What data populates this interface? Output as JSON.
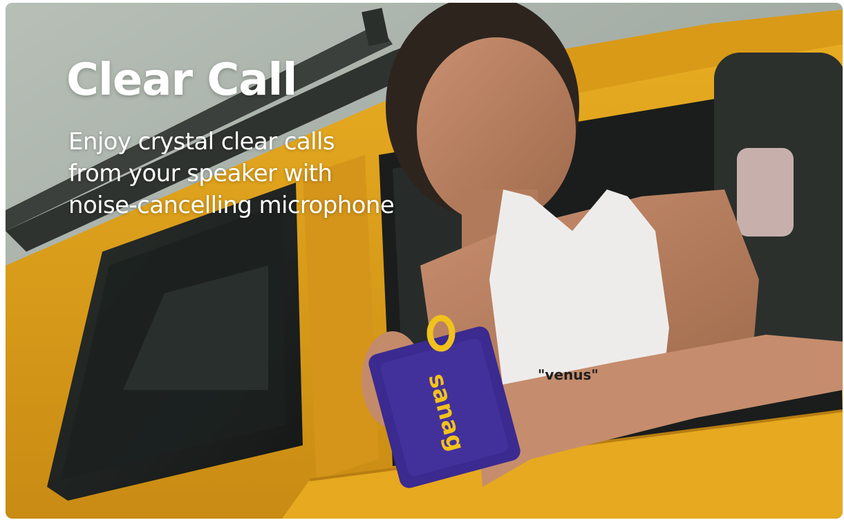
{
  "banner": {
    "headline": "Clear Call",
    "subtext_lines": [
      "Enjoy crystal clear calls",
      "from your speaker with",
      "noise-cancelling microphone"
    ],
    "speaker_brand": "sanag",
    "shirt_text": "\"venus\""
  },
  "colors": {
    "vehicle_yellow": "#e3a41c",
    "speaker_purple": "#3b2a8f",
    "speaker_strap_yellow": "#f2c21c",
    "sky": "#a4ada5"
  },
  "icons": []
}
